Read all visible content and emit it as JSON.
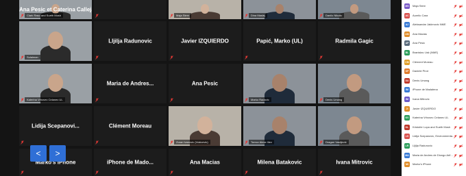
{
  "nav": {
    "prev_label": "<",
    "next_label": ">"
  },
  "tiles": [
    {
      "label": "Ana Pesic et Caterina Calleja",
      "video": true,
      "caption": "Clark Raso and Sueth Mosh"
    },
    {
      "label": "",
      "video": false,
      "caption": ""
    },
    {
      "label": "",
      "video": true,
      "caption": "Maja Stern"
    },
    {
      "label": "",
      "video": true,
      "caption": "Dina Maslej"
    },
    {
      "label": "",
      "video": true,
      "caption": "Danilo Nikolic"
    },
    {
      "label": "",
      "video": true,
      "caption": "Sulaiman"
    },
    {
      "label": "Lljilja Radunovic",
      "video": false,
      "caption": ""
    },
    {
      "label": "Javier IZQUIERDO",
      "video": false,
      "caption": ""
    },
    {
      "label": "Papić, Marko (UL)",
      "video": false,
      "caption": ""
    },
    {
      "label": "Radmila Gagic",
      "video": false,
      "caption": ""
    },
    {
      "label": "",
      "video": true,
      "caption": "Katerina Vrhovec Celanec UL"
    },
    {
      "label": "Maria de Andres...",
      "video": false,
      "caption": ""
    },
    {
      "label": "Ana Pesic",
      "video": false,
      "caption": ""
    },
    {
      "label": "",
      "video": true,
      "caption": "Marko Radovic"
    },
    {
      "label": "",
      "video": true,
      "caption": "Denis Umang"
    },
    {
      "label": "Lidija Scepanovi...",
      "video": false,
      "caption": ""
    },
    {
      "label": "Clément Moreau",
      "video": false,
      "caption": ""
    },
    {
      "label": "",
      "video": true,
      "caption": "Zoran Ivanovic (Vukicevic)"
    },
    {
      "label": "",
      "video": true,
      "caption": "Tomov Alexe Iliev"
    },
    {
      "label": "",
      "video": true,
      "caption": "Dragan Vasiljević"
    },
    {
      "label": "Marko's iPhone",
      "video": false,
      "caption": ""
    },
    {
      "label": "iPhone de Mado...",
      "video": false,
      "caption": ""
    },
    {
      "label": "Ana Macias",
      "video": false,
      "caption": ""
    },
    {
      "label": "Milena Batakovic",
      "video": false,
      "caption": ""
    },
    {
      "label": "Ivana Mitrovic",
      "video": false,
      "caption": ""
    }
  ],
  "participants": [
    {
      "initials": "MS",
      "name": "Maja Stern",
      "color": "#7a5ac8"
    },
    {
      "initials": "AC",
      "name": "Aurelio Cara",
      "color": "#d9534f"
    },
    {
      "initials": "AJ",
      "name": "Aleksandar Jakimovic NME",
      "color": "#3a7bd5"
    },
    {
      "initials": "AM",
      "name": "Ana Macias",
      "color": "#e08e2b"
    },
    {
      "initials": "AP",
      "name": "Ana Pesic",
      "color": "#5a6b7b"
    },
    {
      "initials": "BL",
      "name": "Branislav Lisk (NME)",
      "color": "#2e9e5b"
    },
    {
      "initials": "CM",
      "name": "Clément Moreau",
      "color": "#e0a02b"
    },
    {
      "initials": "DP",
      "name": "Daniele Pirot",
      "color": "#e07b2b"
    },
    {
      "initials": "DU",
      "name": "Denis Umang",
      "color": "#c0392b"
    },
    {
      "initials": "IM",
      "name": "iPhone de Madalena",
      "color": "#3a7bd5"
    },
    {
      "initials": "IM",
      "name": "Ivana Mitrovic",
      "color": "#6b5ac8"
    },
    {
      "initials": "JI",
      "name": "Javier IZQUIERDO",
      "color": "#e08e2b"
    },
    {
      "initials": "KV",
      "name": "Katerina Vrhovec Celanec UL",
      "color": "#2e9e5b"
    },
    {
      "initials": "KL",
      "name": "Kristofer Lopa and Sueth Mosh",
      "color": "#c0392b"
    },
    {
      "initials": "LS",
      "name": "Lidija Scepanovic, Environmenta...",
      "color": "#d9534f"
    },
    {
      "initials": "LR",
      "name": "Lljilja Radunovic",
      "color": "#2e9e5b"
    },
    {
      "initials": "MA",
      "name": "Maria de Andres de Diongo Arif...",
      "color": "#3a7bd5"
    },
    {
      "initials": "MI",
      "name": "Marko's iPhone",
      "color": "#e08e2b"
    }
  ],
  "colors": {
    "accent": "#2f6fd6",
    "muted_red": "#c0392b"
  }
}
